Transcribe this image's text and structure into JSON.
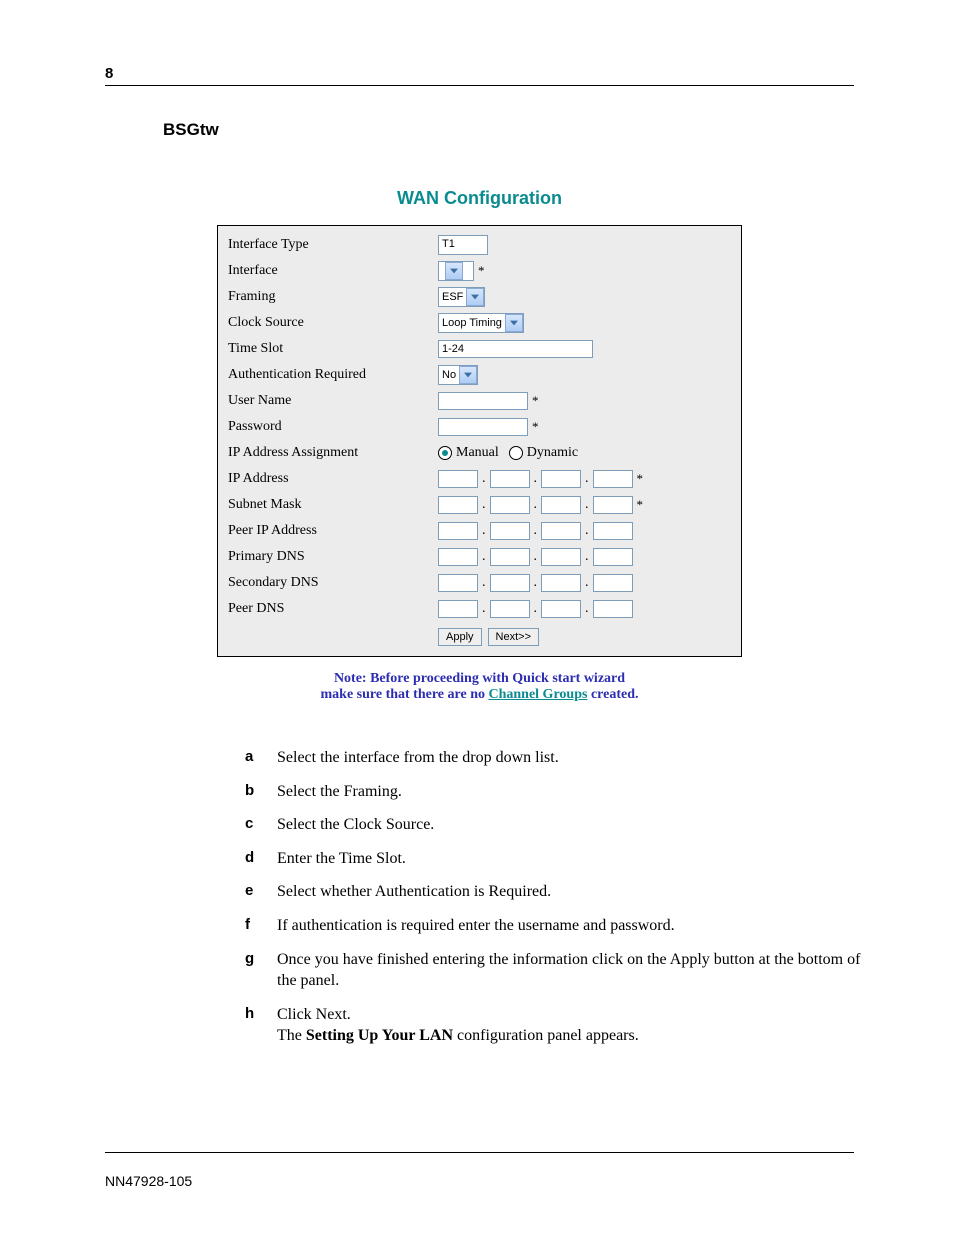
{
  "page_number": "8",
  "section_title": "BSGtw",
  "panel_title": "WAN Configuration",
  "fields": {
    "interface_type_label": "Interface Type",
    "interface_type_value": "T1",
    "interface_label": "Interface",
    "interface_value": "",
    "framing_label": "Framing",
    "framing_value": "ESF",
    "clock_source_label": "Clock Source",
    "clock_source_value": "Loop Timing",
    "time_slot_label": "Time Slot",
    "time_slot_value": "1-24",
    "auth_required_label": "Authentication Required",
    "auth_required_value": "No",
    "user_name_label": "User Name",
    "user_name_value": "",
    "password_label": "Password",
    "password_value": "",
    "ip_assign_label": "IP Address Assignment",
    "ip_assign_manual": "Manual",
    "ip_assign_dynamic": "Dynamic",
    "ip_address_label": "IP Address",
    "subnet_mask_label": "Subnet Mask",
    "peer_ip_label": "Peer IP Address",
    "primary_dns_label": "Primary DNS",
    "secondary_dns_label": "Secondary DNS",
    "peer_dns_label": "Peer DNS"
  },
  "buttons": {
    "apply": "Apply",
    "next": "Next>>"
  },
  "note": {
    "line1": "Note: Before proceeding with Quick start wizard",
    "line2a": "make sure that there are no ",
    "link": "Channel Groups",
    "line2b": " created."
  },
  "instructions": [
    {
      "letter": "a",
      "text": "Select the interface from the drop down list."
    },
    {
      "letter": "b",
      "text": "Select the Framing."
    },
    {
      "letter": "c",
      "text": "Select the Clock Source."
    },
    {
      "letter": "d",
      "text": "Enter the Time Slot."
    },
    {
      "letter": "e",
      "text": "Select whether Authentication is Required."
    },
    {
      "letter": "f",
      "text": "If authentication is required enter the username and password."
    },
    {
      "letter": "g",
      "text": "Once you have finished entering the information click on the Apply button at the bottom of the panel."
    }
  ],
  "instruction_h": {
    "letter": "h",
    "line1": "Click Next.",
    "line2a": "The ",
    "bold": "Setting Up Your LAN",
    "line2b": " configuration panel appears."
  },
  "footer": "NN47928-105",
  "asterisk": "*",
  "dot": "."
}
